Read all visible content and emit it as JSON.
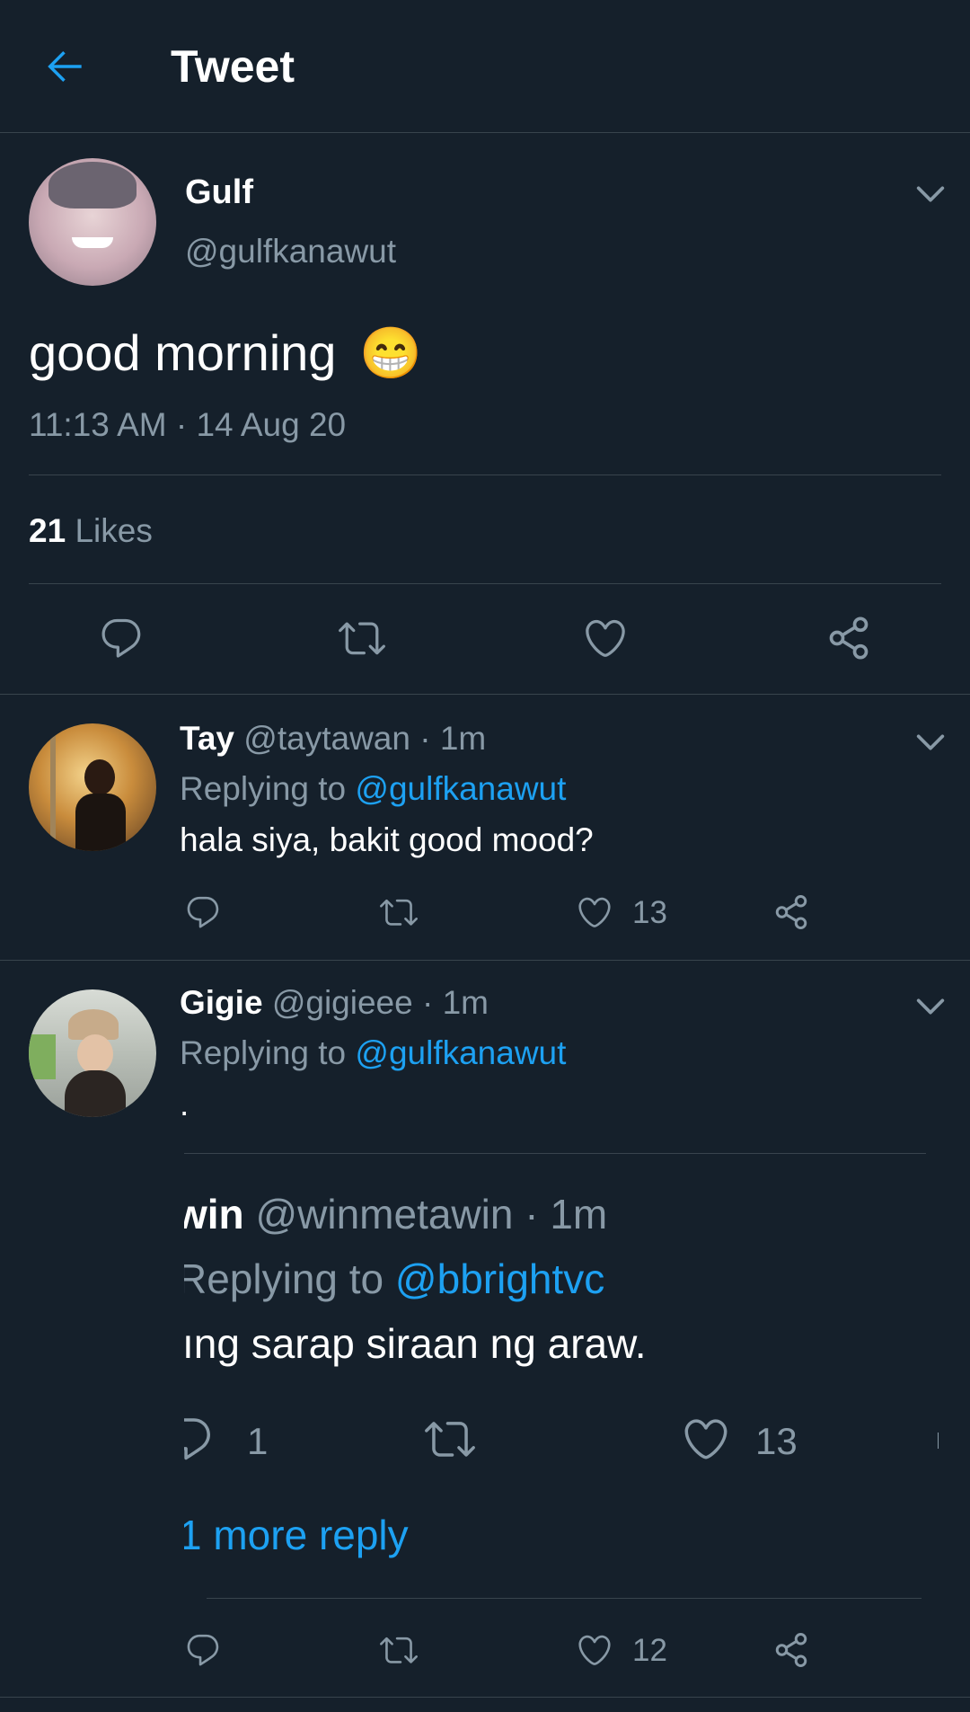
{
  "header": {
    "title": "Tweet"
  },
  "main_tweet": {
    "name": "Gulf",
    "handle": "@gulfkanawut",
    "text": "good morning",
    "emoji": "😁",
    "timestamp": "11:13 AM · 14 Aug 20",
    "likes_count": "21",
    "likes_label": "Likes"
  },
  "replies": [
    {
      "name": "Tay",
      "meta": "@taytawan · 1m",
      "replying_prefix": "Replying to",
      "replying_handle": "@gulfkanawut",
      "text": "hala siya, bakit good mood?",
      "like_count": "13"
    },
    {
      "name": "Gigie",
      "meta": "@gigieee · 1m",
      "replying_prefix": "Replying to",
      "replying_handle": "@gulfkanawut",
      "text": ".",
      "like_count": "12"
    }
  ],
  "embedded_screenshot": {
    "name": "win",
    "meta": "@winmetawin · 1m",
    "replying_prefix": "Replying to",
    "replying_handle": "@bbrightvc",
    "text": "ıng sarap siraan ng araw.",
    "reply_count": "1",
    "like_count": "13",
    "more_replies": "1 more reply"
  },
  "colors": {
    "background": "#15202b",
    "accent": "#1da1f2",
    "muted": "#8899a6",
    "divider": "#38444d"
  },
  "icons": [
    "back-arrow-icon",
    "chevron-down-icon",
    "reply-icon",
    "retweet-icon",
    "like-icon",
    "share-icon"
  ]
}
